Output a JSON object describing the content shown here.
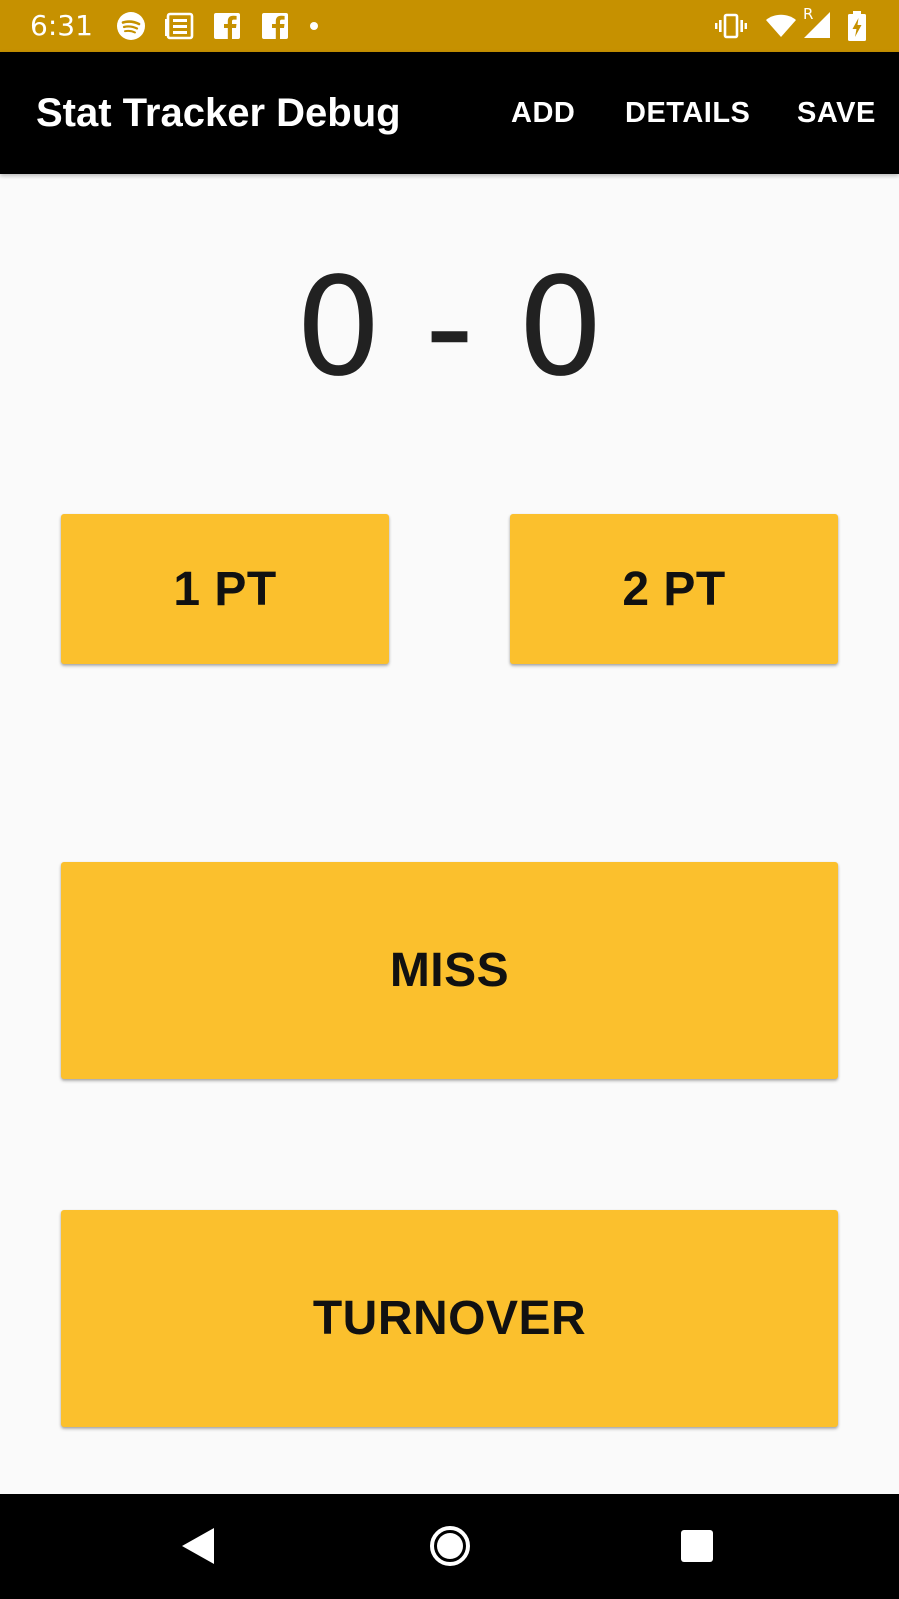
{
  "status_bar": {
    "time": "6:31",
    "left_icons": [
      "spotify-icon",
      "news-icon",
      "facebook-icon",
      "facebook-icon",
      "notification-dot-icon"
    ],
    "right_icons": [
      "vibrate-icon",
      "wifi-icon",
      "signal-roaming-icon",
      "battery-charging-icon"
    ],
    "roaming_label": "R",
    "color": "#C69100"
  },
  "app_bar": {
    "title": "Stat Tracker Debug",
    "actions": {
      "add": "ADD",
      "details": "DETAILS",
      "save": "SAVE"
    },
    "color": "#000000"
  },
  "score": {
    "text": "0 - 0"
  },
  "buttons": {
    "one_pt": "1 PT",
    "two_pt": "2 PT",
    "miss": "MISS",
    "turnover": "TURNOVER",
    "color": "#FBC02D"
  },
  "nav_bar": {
    "icons": [
      "back-icon",
      "home-icon",
      "recents-icon"
    ]
  }
}
